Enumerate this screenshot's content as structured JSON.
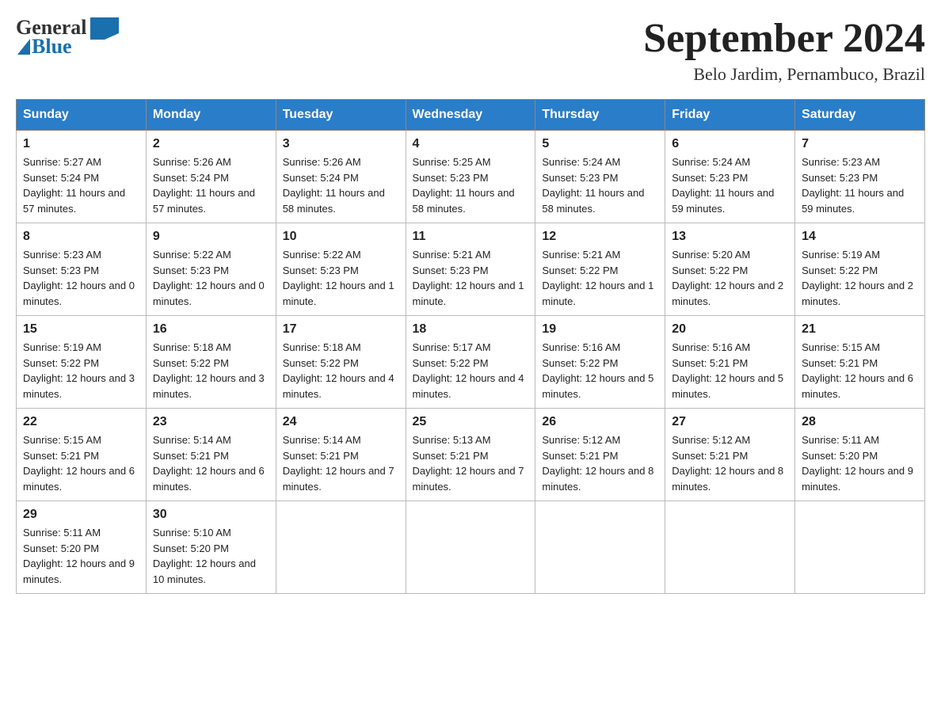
{
  "header": {
    "logo_general": "General",
    "logo_blue": "Blue",
    "title": "September 2024",
    "subtitle": "Belo Jardim, Pernambuco, Brazil"
  },
  "days_of_week": [
    "Sunday",
    "Monday",
    "Tuesday",
    "Wednesday",
    "Thursday",
    "Friday",
    "Saturday"
  ],
  "weeks": [
    [
      {
        "day": "1",
        "sunrise": "5:27 AM",
        "sunset": "5:24 PM",
        "daylight": "11 hours and 57 minutes."
      },
      {
        "day": "2",
        "sunrise": "5:26 AM",
        "sunset": "5:24 PM",
        "daylight": "11 hours and 57 minutes."
      },
      {
        "day": "3",
        "sunrise": "5:26 AM",
        "sunset": "5:24 PM",
        "daylight": "11 hours and 58 minutes."
      },
      {
        "day": "4",
        "sunrise": "5:25 AM",
        "sunset": "5:23 PM",
        "daylight": "11 hours and 58 minutes."
      },
      {
        "day": "5",
        "sunrise": "5:24 AM",
        "sunset": "5:23 PM",
        "daylight": "11 hours and 58 minutes."
      },
      {
        "day": "6",
        "sunrise": "5:24 AM",
        "sunset": "5:23 PM",
        "daylight": "11 hours and 59 minutes."
      },
      {
        "day": "7",
        "sunrise": "5:23 AM",
        "sunset": "5:23 PM",
        "daylight": "11 hours and 59 minutes."
      }
    ],
    [
      {
        "day": "8",
        "sunrise": "5:23 AM",
        "sunset": "5:23 PM",
        "daylight": "12 hours and 0 minutes."
      },
      {
        "day": "9",
        "sunrise": "5:22 AM",
        "sunset": "5:23 PM",
        "daylight": "12 hours and 0 minutes."
      },
      {
        "day": "10",
        "sunrise": "5:22 AM",
        "sunset": "5:23 PM",
        "daylight": "12 hours and 1 minute."
      },
      {
        "day": "11",
        "sunrise": "5:21 AM",
        "sunset": "5:23 PM",
        "daylight": "12 hours and 1 minute."
      },
      {
        "day": "12",
        "sunrise": "5:21 AM",
        "sunset": "5:22 PM",
        "daylight": "12 hours and 1 minute."
      },
      {
        "day": "13",
        "sunrise": "5:20 AM",
        "sunset": "5:22 PM",
        "daylight": "12 hours and 2 minutes."
      },
      {
        "day": "14",
        "sunrise": "5:19 AM",
        "sunset": "5:22 PM",
        "daylight": "12 hours and 2 minutes."
      }
    ],
    [
      {
        "day": "15",
        "sunrise": "5:19 AM",
        "sunset": "5:22 PM",
        "daylight": "12 hours and 3 minutes."
      },
      {
        "day": "16",
        "sunrise": "5:18 AM",
        "sunset": "5:22 PM",
        "daylight": "12 hours and 3 minutes."
      },
      {
        "day": "17",
        "sunrise": "5:18 AM",
        "sunset": "5:22 PM",
        "daylight": "12 hours and 4 minutes."
      },
      {
        "day": "18",
        "sunrise": "5:17 AM",
        "sunset": "5:22 PM",
        "daylight": "12 hours and 4 minutes."
      },
      {
        "day": "19",
        "sunrise": "5:16 AM",
        "sunset": "5:22 PM",
        "daylight": "12 hours and 5 minutes."
      },
      {
        "day": "20",
        "sunrise": "5:16 AM",
        "sunset": "5:21 PM",
        "daylight": "12 hours and 5 minutes."
      },
      {
        "day": "21",
        "sunrise": "5:15 AM",
        "sunset": "5:21 PM",
        "daylight": "12 hours and 6 minutes."
      }
    ],
    [
      {
        "day": "22",
        "sunrise": "5:15 AM",
        "sunset": "5:21 PM",
        "daylight": "12 hours and 6 minutes."
      },
      {
        "day": "23",
        "sunrise": "5:14 AM",
        "sunset": "5:21 PM",
        "daylight": "12 hours and 6 minutes."
      },
      {
        "day": "24",
        "sunrise": "5:14 AM",
        "sunset": "5:21 PM",
        "daylight": "12 hours and 7 minutes."
      },
      {
        "day": "25",
        "sunrise": "5:13 AM",
        "sunset": "5:21 PM",
        "daylight": "12 hours and 7 minutes."
      },
      {
        "day": "26",
        "sunrise": "5:12 AM",
        "sunset": "5:21 PM",
        "daylight": "12 hours and 8 minutes."
      },
      {
        "day": "27",
        "sunrise": "5:12 AM",
        "sunset": "5:21 PM",
        "daylight": "12 hours and 8 minutes."
      },
      {
        "day": "28",
        "sunrise": "5:11 AM",
        "sunset": "5:20 PM",
        "daylight": "12 hours and 9 minutes."
      }
    ],
    [
      {
        "day": "29",
        "sunrise": "5:11 AM",
        "sunset": "5:20 PM",
        "daylight": "12 hours and 9 minutes."
      },
      {
        "day": "30",
        "sunrise": "5:10 AM",
        "sunset": "5:20 PM",
        "daylight": "12 hours and 10 minutes."
      },
      null,
      null,
      null,
      null,
      null
    ]
  ],
  "labels": {
    "sunrise": "Sunrise:",
    "sunset": "Sunset:",
    "daylight": "Daylight:"
  }
}
